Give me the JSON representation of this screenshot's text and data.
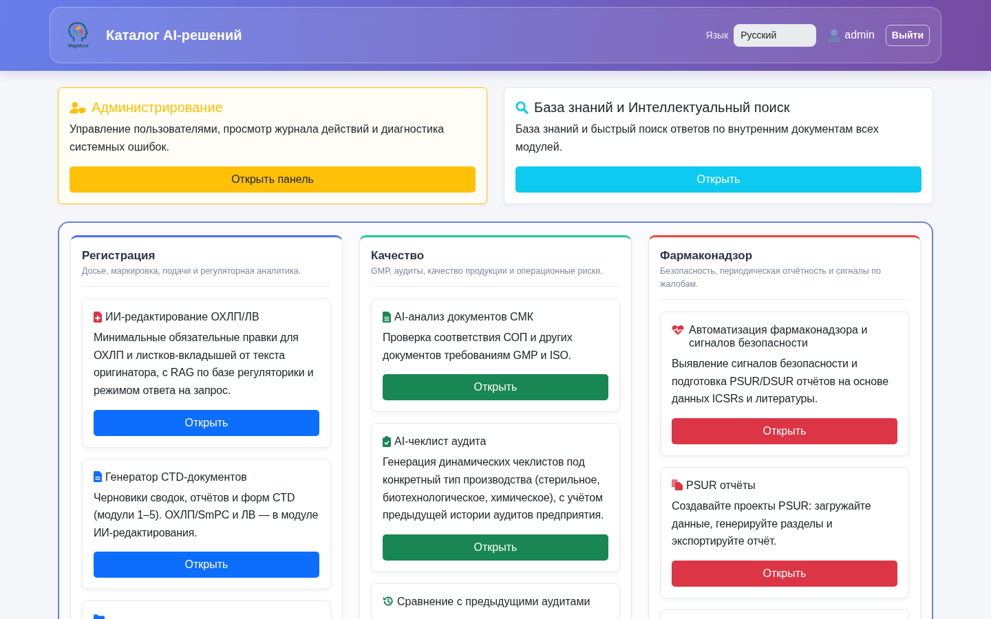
{
  "header": {
    "logo_text": "ФарМозг",
    "title": "Каталог AI-решений",
    "language_label": "Язык",
    "language": "Русский",
    "user": "admin",
    "logout": "Выйти"
  },
  "top_cards": [
    {
      "kind": "admin",
      "title": "Администрирование",
      "description": "Управление пользователями, просмотр журнала действий и диагностика системных ошибок.",
      "button": "Открыть панель"
    },
    {
      "kind": "search",
      "title": "База знаний и Интеллектуальный поиск",
      "description": "База знаний и быстрый поиск ответов по внутренним документам всех модулей.",
      "button": "Открыть"
    }
  ],
  "categories": [
    {
      "title": "Регистрация",
      "subtitle": "Досье, маркировка, подачи и регуляторная аналитика.",
      "color": "#4f70ec",
      "items": [
        {
          "kind": "module",
          "title": "ИИ-редактирование ОХЛП/ЛВ",
          "description": "Минимальные обязательные правки для ОХЛП и листков-вкладышей от текста оригинатора, с RAG по базе регуляторики и режимом ответа на запрос.",
          "button": "Открыть"
        },
        {
          "kind": "module",
          "title": "Генератор CTD-документов",
          "description": "Черновики сводок, отчётов и форм CTD (модули 1–5). ОХЛП/SmPC и ЛВ — в модуле ИИ-редактирования.",
          "button": "Открыть"
        },
        {
          "kind": "cut_off"
        }
      ]
    },
    {
      "title": "Качество",
      "subtitle": "GMP, аудиты, качество продукции и операционные риски.",
      "color": "#20c58c",
      "items": [
        {
          "kind": "module",
          "title": "AI-анализ документов СМК",
          "description": "Проверка соответствия СОП и других документов требованиям GMP и ISO.",
          "button": "Открыть"
        },
        {
          "kind": "module",
          "title": "AI-чеклист аудита",
          "description": "Генерация динамических чеклистов под конкретный тип производства (стерильное, биотехнологическое, химическое), с учётом предыдущей истории аудитов предприятия.",
          "button": "Открыть"
        },
        {
          "kind": "module",
          "title": "Сравнение с предыдущими аудитами"
        }
      ]
    },
    {
      "title": "Фармаконадзор",
      "subtitle": "Безопасность, периодическая отчётность и сигналы по жалобам.",
      "color": "#e8473c",
      "items": [
        {
          "kind": "module",
          "title": "Автоматизация фармаконадзора и сигналов безопасности",
          "description": "Выявление сигналов безопасности и подготовка PSUR/DSUR отчётов на основе данных ICSRs и литературы.",
          "button": "Открыть"
        },
        {
          "kind": "module",
          "title": "PSUR отчёты",
          "description": "Создавайте проекты PSUR: загружайте данные, генерируйте разделы и экспортируйте отчёт.",
          "button": "Открыть"
        },
        {
          "kind": "cut_off"
        }
      ]
    }
  ]
}
